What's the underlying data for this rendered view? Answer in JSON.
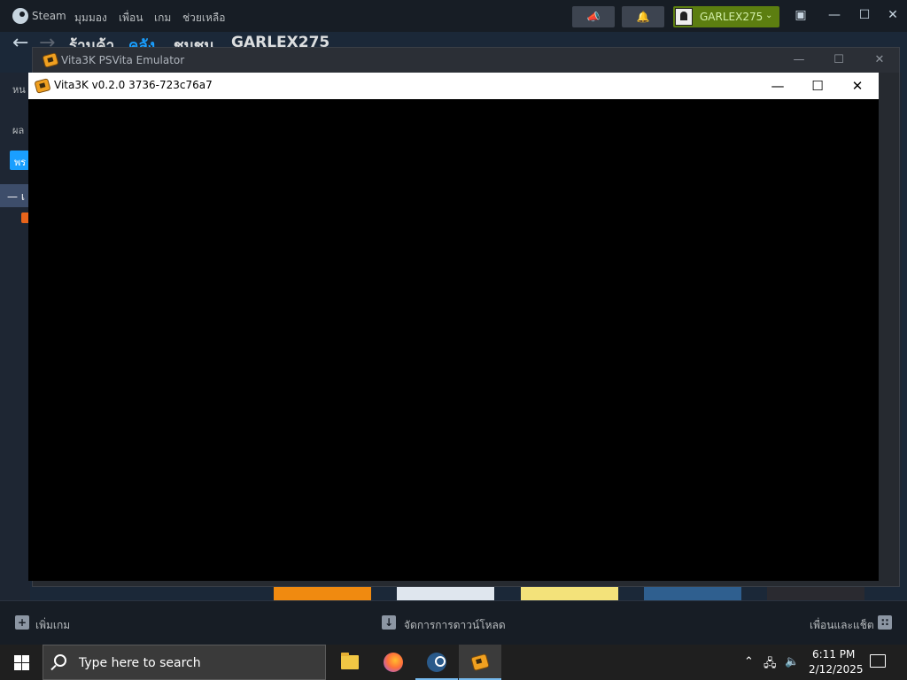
{
  "steam": {
    "brand": "Steam",
    "menu": [
      "มุมมอง",
      "เพื่อน",
      "เกม",
      "ช่วยเหลือ"
    ],
    "username": "GARLEX275",
    "nav": {
      "store": "ร้านค้า",
      "library": "คลัง",
      "community": "ชุมชน",
      "profile": "GARLEX275"
    },
    "sidebar_fragments": {
      "home": "หน",
      "results": "ผล",
      "button": "พร",
      "section": "— เ"
    },
    "bottom": {
      "add_game": "เพิ่มเกม",
      "manage_downloads": "จัดการการดาวน์โหลด",
      "friends_chat": "เพื่อนและแช็ต"
    }
  },
  "emulator": {
    "outer_title": "Vita3K PSVita Emulator",
    "inner_title": "Vita3K v0.2.0 3736-723c76a7"
  },
  "taskbar": {
    "search_placeholder": "Type here to search",
    "time": "6:11 PM",
    "date": "2/12/2025"
  },
  "colors": {
    "steam_bg": "#1b2838",
    "steam_accent": "#1a9fff",
    "account_green": "#5c7e10",
    "taskbar_bg": "#1f1f1f",
    "taskbar_active_underline": "#76b9ed"
  },
  "icons": [
    "steam-logo-icon",
    "megaphone-icon",
    "bell-icon",
    "monitor-icon",
    "back-arrow-icon",
    "forward-arrow-icon",
    "vita3k-icon",
    "windows-start-icon",
    "search-icon",
    "file-explorer-icon",
    "firefox-icon",
    "steam-icon",
    "chevron-up-icon",
    "network-icon",
    "volume-icon",
    "notification-icon"
  ]
}
